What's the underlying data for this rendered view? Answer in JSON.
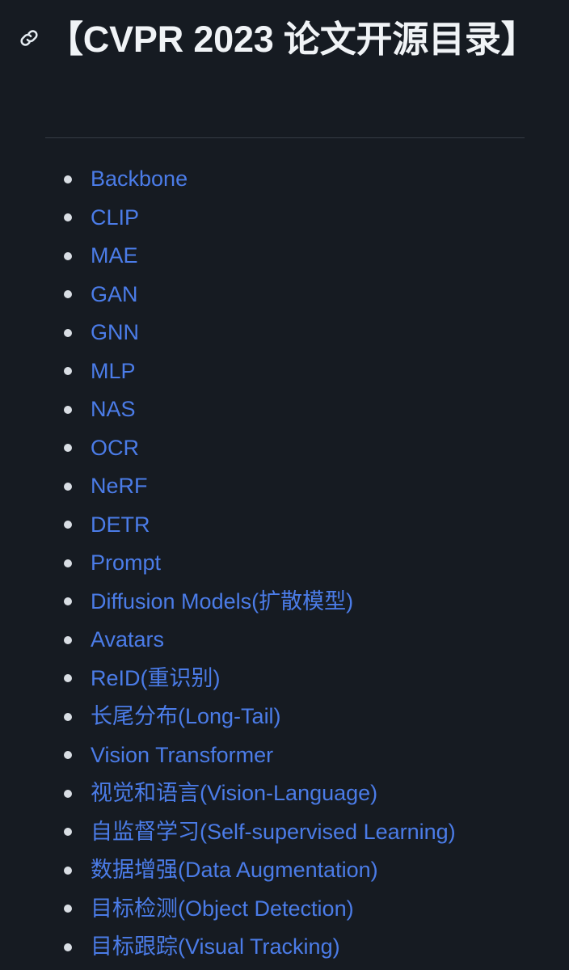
{
  "theme": {
    "background": "#161b22",
    "heading_color": "#f0f3f6",
    "link_color": "#4b7ce8",
    "bullet_color": "#d9dee4",
    "divider_color": "#363c45"
  },
  "header": {
    "anchor_icon": "link-icon",
    "title": "【CVPR 2023 论文开源目录】"
  },
  "toc": {
    "items": [
      {
        "label": "Backbone"
      },
      {
        "label": "CLIP"
      },
      {
        "label": "MAE"
      },
      {
        "label": "GAN"
      },
      {
        "label": "GNN"
      },
      {
        "label": "MLP"
      },
      {
        "label": "NAS"
      },
      {
        "label": "OCR"
      },
      {
        "label": "NeRF"
      },
      {
        "label": "DETR"
      },
      {
        "label": "Prompt"
      },
      {
        "label": "Diffusion Models(扩散模型)"
      },
      {
        "label": "Avatars"
      },
      {
        "label": "ReID(重识别)"
      },
      {
        "label": "长尾分布(Long-Tail)"
      },
      {
        "label": "Vision Transformer"
      },
      {
        "label": "视觉和语言(Vision-Language)"
      },
      {
        "label": "自监督学习(Self-supervised Learning)"
      },
      {
        "label": "数据增强(Data Augmentation)"
      },
      {
        "label": "目标检测(Object Detection)"
      },
      {
        "label": "目标跟踪(Visual Tracking)"
      }
    ]
  }
}
